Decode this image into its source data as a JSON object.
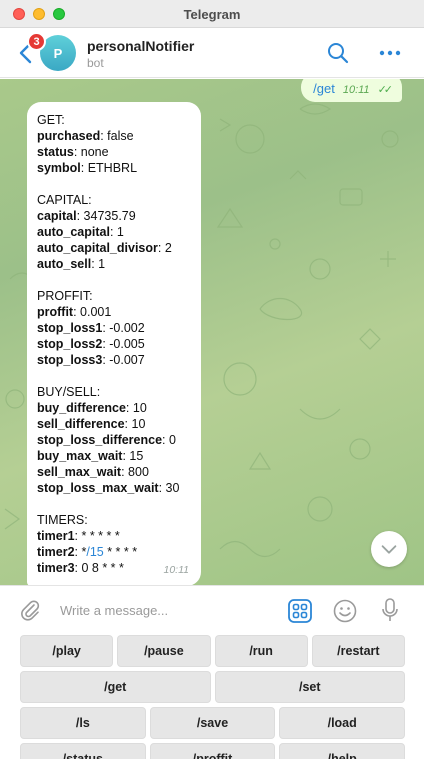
{
  "window": {
    "title": "Telegram"
  },
  "header": {
    "unread_count": "3",
    "avatar_letter": "P",
    "avatar_color": "#3aa8c4",
    "chat_name": "personalNotifier",
    "chat_status": "bot"
  },
  "chat": {
    "outgoing": {
      "text": "/get",
      "time": "10:11",
      "ticks": "✓✓"
    },
    "incoming": {
      "time": "10:11",
      "sections": {
        "get": {
          "heading": "GET:",
          "purchased_key": "purchased",
          "purchased_val": ": false",
          "status_key": "status",
          "status_val": ": none",
          "symbol_key": "symbol",
          "symbol_val": ": ETHBRL"
        },
        "capital": {
          "heading": "CAPITAL:",
          "capital_key": "capital",
          "capital_val": ": 34735.79",
          "auto_capital_key": "auto_capital",
          "auto_capital_val": ": 1",
          "auto_capital_divisor_key": "auto_capital_divisor",
          "auto_capital_divisor_val": ": 2",
          "auto_sell_key": "auto_sell",
          "auto_sell_val": ": 1"
        },
        "proffit": {
          "heading": "PROFFIT:",
          "proffit_key": "proffit",
          "proffit_val": ": 0.001",
          "stop_loss1_key": "stop_loss1",
          "stop_loss1_val": ": -0.002",
          "stop_loss2_key": "stop_loss2",
          "stop_loss2_val": ": -0.005",
          "stop_loss3_key": "stop_loss3",
          "stop_loss3_val": ": -0.007"
        },
        "buysell": {
          "heading": "BUY/SELL:",
          "buy_difference_key": "buy_difference",
          "buy_difference_val": ": 10",
          "sell_difference_key": "sell_difference",
          "sell_difference_val": ": 10",
          "stop_loss_difference_key": "stop_loss_difference",
          "stop_loss_difference_val": ": 0",
          "buy_max_wait_key": "buy_max_wait",
          "buy_max_wait_val": ": 15",
          "sell_max_wait_key": "sell_max_wait",
          "sell_max_wait_val": ": 800",
          "stop_loss_max_wait_key": "stop_loss_max_wait",
          "stop_loss_max_wait_val": ": 30"
        },
        "timers": {
          "heading": "TIMERS:",
          "timer1_key": "timer1",
          "timer1_val": ": * * * * *",
          "timer2_key": "timer2",
          "timer2_pre": ": *",
          "timer2_link": "/15",
          "timer2_post": " * * * *",
          "timer3_key": "timer3",
          "timer3_val": ": 0 8 * * *"
        }
      }
    }
  },
  "composer": {
    "placeholder": "Write a message..."
  },
  "keyboard": {
    "row1": [
      "/play",
      "/pause",
      "/run",
      "/restart"
    ],
    "row2": [
      "/get",
      "/set"
    ],
    "row3": [
      "/ls",
      "/save",
      "/load"
    ],
    "row4": [
      "/status",
      "/proffit",
      "/help"
    ]
  },
  "icons": {
    "back": "chevron-left-icon",
    "search": "search-icon",
    "more": "more-dots-icon",
    "attach": "paperclip-icon",
    "bot_keyboard": "keyboard-grid-icon",
    "emoji": "emoji-icon",
    "mic": "microphone-icon",
    "scroll": "chevron-down-icon"
  },
  "colors": {
    "accent": "#2b86d6",
    "badge": "#e53935",
    "outgoing_bubble": "#effdde"
  }
}
